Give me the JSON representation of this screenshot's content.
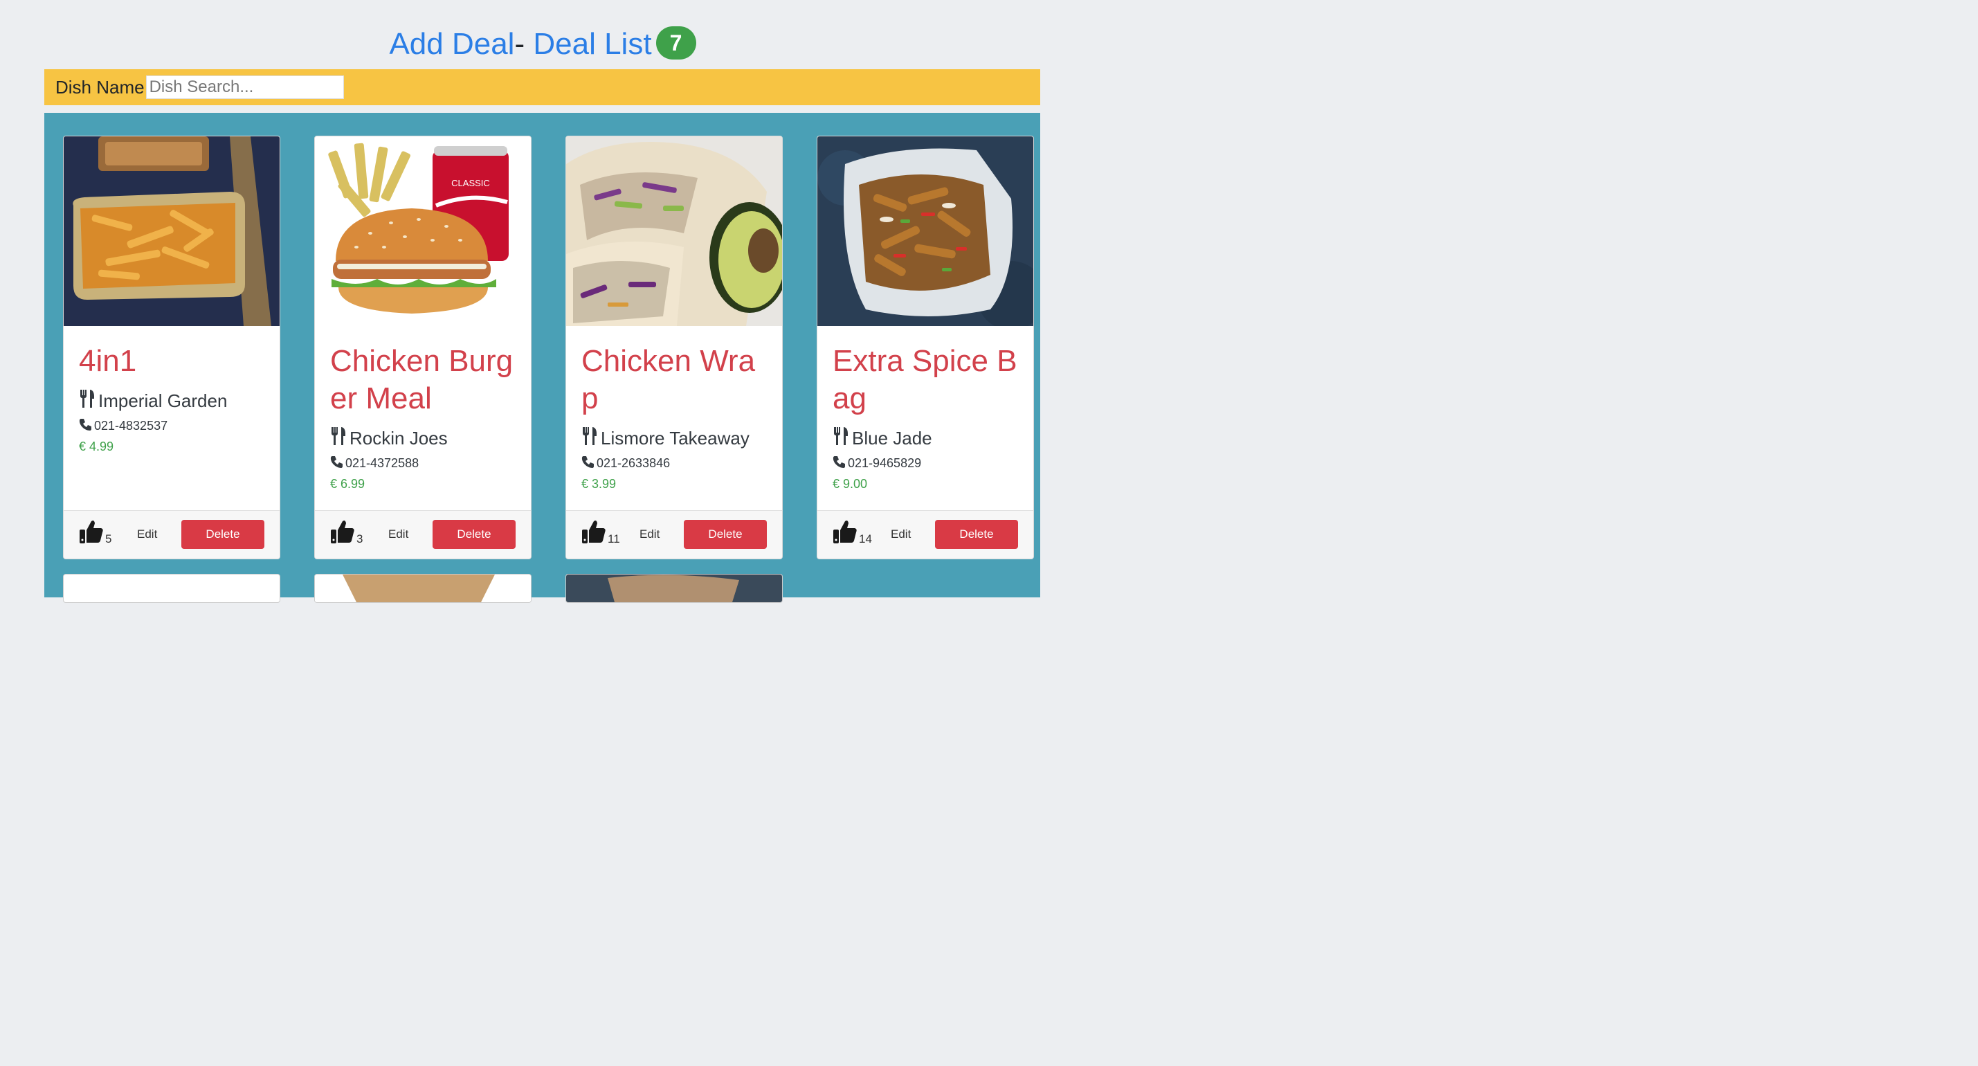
{
  "header": {
    "add_deal": "Add Deal",
    "separator": "- ",
    "deal_list": "Deal List",
    "count": "7"
  },
  "search": {
    "label": "Dish Name",
    "placeholder": "Dish Search..."
  },
  "deals": [
    {
      "name": "4in1",
      "restaurant": "Imperial Garden",
      "phone": "021-4832537",
      "price": "€ 4.99",
      "likes": "5",
      "edit": "Edit",
      "delete": "Delete"
    },
    {
      "name": "Chicken Burger Meal",
      "restaurant": "Rockin Joes",
      "phone": "021-4372588",
      "price": "€ 6.99",
      "likes": "3",
      "edit": "Edit",
      "delete": "Delete"
    },
    {
      "name": "Chicken Wrap",
      "restaurant": "Lismore Takeaway",
      "phone": "021-2633846",
      "price": "€ 3.99",
      "likes": "11",
      "edit": "Edit",
      "delete": "Delete"
    },
    {
      "name": "Extra Spice Bag",
      "restaurant": "Blue Jade",
      "phone": "021-9465829",
      "price": "€ 9.00",
      "likes": "14",
      "edit": "Edit",
      "delete": "Delete"
    }
  ],
  "colors": {
    "link": "#2b7ee6",
    "badge": "#3fa14a",
    "searchbar": "#f7c443",
    "panel": "#4aa0b6",
    "dish_name": "#d2414b",
    "delete_button": "#d93a45"
  }
}
